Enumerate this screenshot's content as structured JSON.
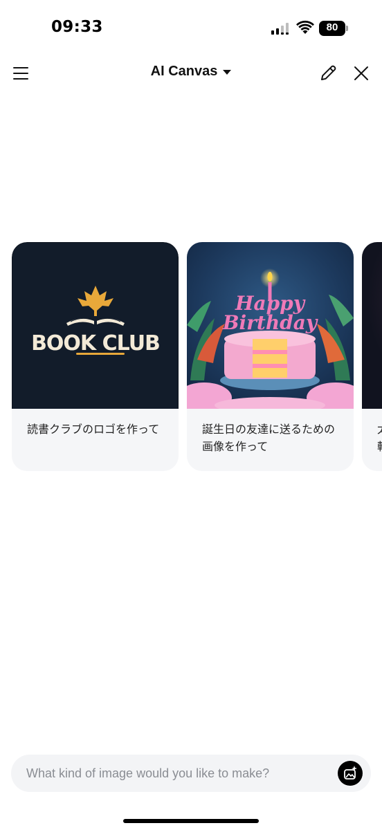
{
  "status_bar": {
    "time": "09:33",
    "battery": "80",
    "icons": [
      "signal-icon",
      "wifi-icon",
      "battery-icon"
    ]
  },
  "header": {
    "title": "AI Canvas",
    "icons": [
      "menu-icon",
      "chevron-down-icon",
      "edit-icon",
      "close-icon"
    ]
  },
  "suggestions": [
    {
      "image_text": "BOOK CLUB",
      "caption": "読書クラブのロゴを作って"
    },
    {
      "image_text_line1": "Happy",
      "image_text_line2": "Birthday",
      "caption_line1": "誕生日の友達に送るための",
      "caption_line2": "画像を作って"
    },
    {
      "caption_line1": "太",
      "caption_line2": "軌"
    }
  ],
  "composer": {
    "placeholder": "What kind of image would you like to make?",
    "icon": "image-sparkle-icon"
  },
  "colors": {
    "accent": "#000000",
    "card_bg": "#f5f6f8",
    "composer_bg": "#f3f4f6",
    "logo_gold": "#e8a83a",
    "logo_cream": "#f3ead7",
    "cake_pink": "#f07ab8"
  }
}
